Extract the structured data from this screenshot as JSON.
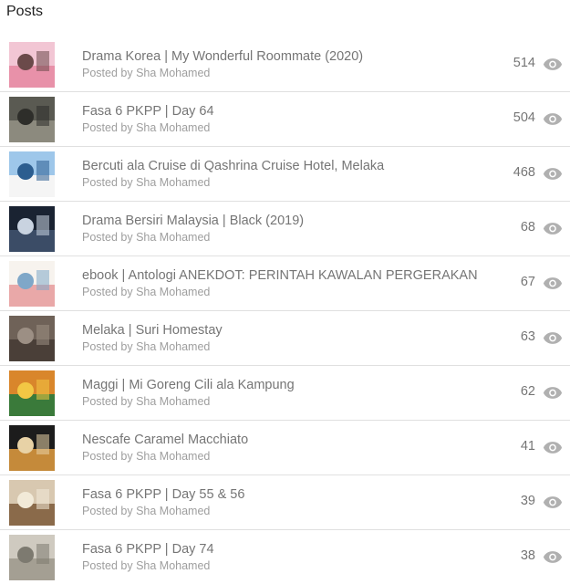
{
  "header": {
    "title": "Posts"
  },
  "posts": [
    {
      "title": "Drama Korea | My Wonderful Roommate (2020)",
      "author": "Posted by Sha Mohamed",
      "views": "514",
      "thumb_colors": [
        "#f2c6d4",
        "#e891a9",
        "#6b4a4a"
      ]
    },
    {
      "title": "Fasa 6 PKPP | Day 64",
      "author": "Posted by Sha Mohamed",
      "views": "504",
      "thumb_colors": [
        "#5a5a52",
        "#8c8a7e",
        "#2e2e2a"
      ]
    },
    {
      "title": "Bercuti ala Cruise di Qashrina Cruise Hotel, Melaka",
      "author": "Posted by Sha Mohamed",
      "views": "468",
      "thumb_colors": [
        "#9ec7ea",
        "#f5f5f5",
        "#2c5d8f"
      ]
    },
    {
      "title": "Drama Bersiri Malaysia | Black (2019)",
      "author": "Posted by Sha Mohamed",
      "views": "68",
      "thumb_colors": [
        "#1a2332",
        "#3b4c66",
        "#c9d3e0"
      ]
    },
    {
      "title": "ebook | Antologi ANEKDOT: PERINTAH KAWALAN PERGERAKAN",
      "author": "Posted by Sha Mohamed",
      "views": "67",
      "thumb_colors": [
        "#f7f3ee",
        "#e9a8a8",
        "#7fa7c8"
      ]
    },
    {
      "title": "Melaka | Suri Homestay",
      "author": "Posted by Sha Mohamed",
      "views": "63",
      "thumb_colors": [
        "#6f6258",
        "#4a3f38",
        "#9c8f84"
      ]
    },
    {
      "title": "Maggi | Mi Goreng Cili ala Kampung",
      "author": "Posted by Sha Mohamed",
      "views": "62",
      "thumb_colors": [
        "#d9862b",
        "#3a7a3a",
        "#f2c744"
      ]
    },
    {
      "title": "Nescafe Caramel Macchiato",
      "author": "Posted by Sha Mohamed",
      "views": "41",
      "thumb_colors": [
        "#1c1c1c",
        "#c58a3a",
        "#e8d2a6"
      ]
    },
    {
      "title": "Fasa 6 PKPP | Day 55 & 56",
      "author": "Posted by Sha Mohamed",
      "views": "39",
      "thumb_colors": [
        "#d8c8b0",
        "#8a6a4a",
        "#f2ead8"
      ]
    },
    {
      "title": "Fasa 6 PKPP | Day 74",
      "author": "Posted by Sha Mohamed",
      "views": "38",
      "thumb_colors": [
        "#cfcac0",
        "#a49f93",
        "#7d7a70"
      ]
    }
  ],
  "icons": {
    "views": "eye-icon"
  },
  "colors": {
    "accent_text": "#757575",
    "icon": "#b0b0b0",
    "divider": "#e0e0e0"
  }
}
